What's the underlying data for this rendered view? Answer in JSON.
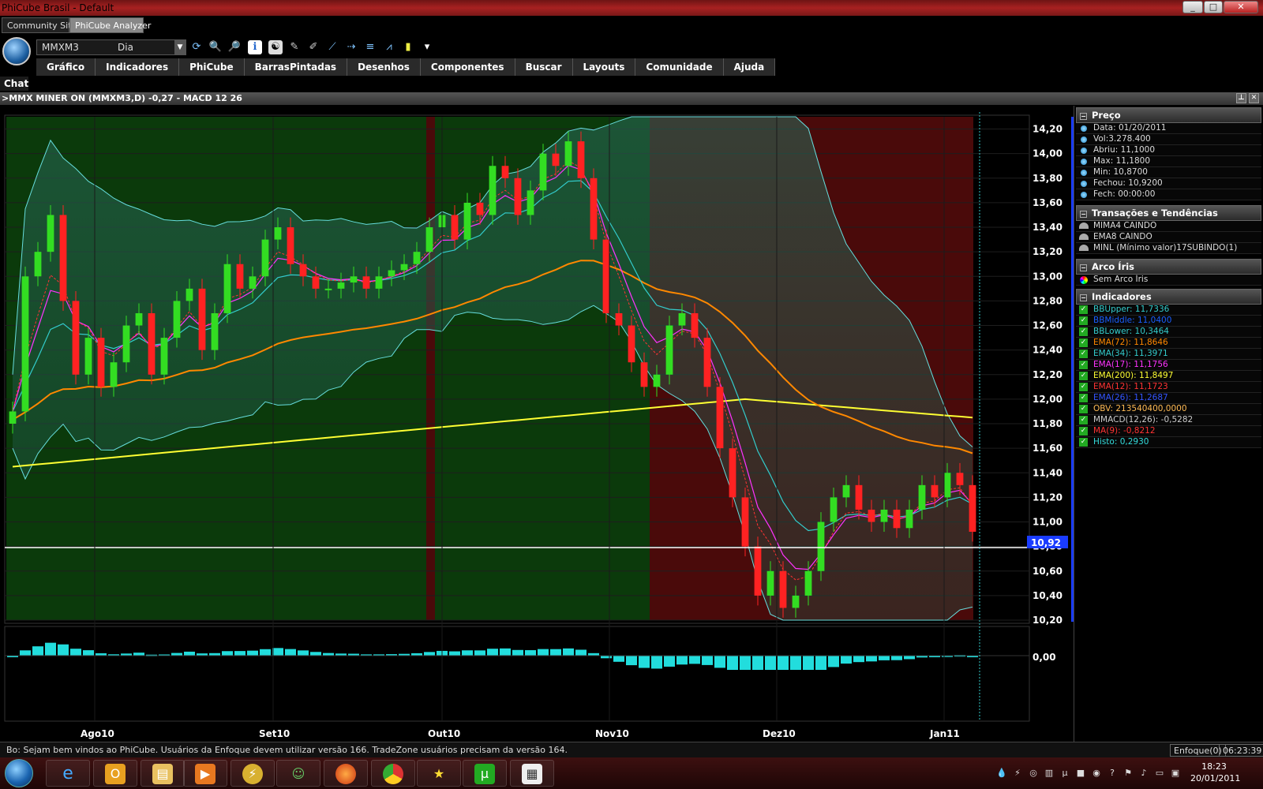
{
  "window": {
    "title": "PhiCube Brasil - Default",
    "buttons": [
      "minimize",
      "maximize",
      "close"
    ]
  },
  "web_tabs": [
    "Community Site",
    "PhiCube Analyzer"
  ],
  "toolbar": {
    "symbol": "MMXM3",
    "period": "Dia",
    "icons": [
      "refresh-icon",
      "zoom-out-icon",
      "zoom-in-icon",
      "info-icon",
      "yin-yang-icon",
      "paint-icon",
      "draw-icon",
      "line-icon",
      "hline-icon",
      "fibonacci-icon",
      "candle-icon",
      "more-icon"
    ]
  },
  "menu": [
    "Gráfico",
    "Indicadores",
    "PhiCube",
    "BarrasPintadas",
    "Desenhos",
    "Componentes",
    "Buscar",
    "Layouts",
    "Comunidade",
    "Ajuda"
  ],
  "chat_label": "Chat",
  "chart_header": ">MMX MINER  ON  (MMXM3,D)  -0,27 - MACD 12 26",
  "chart_data": {
    "type": "candlestick",
    "symbol": "MMXM3",
    "x_labels": [
      "Ago10",
      "Set10",
      "Out10",
      "Nov10",
      "Dez10",
      "Jan11"
    ],
    "y_ticks": [
      "14,20",
      "14,00",
      "13,80",
      "13,60",
      "13,40",
      "13,20",
      "13,00",
      "12,80",
      "12,60",
      "12,40",
      "12,20",
      "12,00",
      "11,80",
      "11,60",
      "11,40",
      "11,20",
      "11,00",
      "10,80",
      "10,60",
      "10,40",
      "10,20"
    ],
    "ylim": [
      10.2,
      14.3
    ],
    "current_price": "10,92",
    "closes": [
      11.9,
      13.0,
      13.2,
      13.5,
      12.8,
      12.2,
      12.5,
      12.1,
      12.3,
      12.6,
      12.7,
      12.2,
      12.5,
      12.8,
      12.9,
      12.4,
      12.7,
      13.1,
      12.9,
      13.0,
      13.3,
      13.4,
      13.1,
      13.0,
      12.9,
      12.9,
      12.95,
      13.0,
      12.9,
      13.0,
      13.05,
      13.1,
      13.2,
      13.4,
      13.5,
      13.3,
      13.6,
      13.5,
      13.9,
      13.8,
      13.5,
      13.7,
      14.0,
      13.9,
      14.1,
      13.8,
      13.3,
      12.7,
      12.6,
      12.3,
      12.1,
      12.2,
      12.6,
      12.7,
      12.5,
      12.1,
      11.6,
      11.2,
      10.8,
      10.4,
      10.6,
      10.3,
      10.4,
      10.6,
      11.0,
      11.2,
      11.3,
      11.1,
      11.0,
      11.1,
      10.95,
      11.1,
      11.3,
      11.2,
      11.4,
      11.3,
      10.92
    ],
    "overlays": [
      {
        "name": "EMA(200)",
        "color": "#ffff33"
      },
      {
        "name": "EMA(72)",
        "color": "#ff8800"
      },
      {
        "name": "EMA(34)",
        "color": "#33cccc"
      },
      {
        "name": "EMA(17)",
        "color": "#ff33ff"
      },
      {
        "name": "EMA(12)",
        "color": "#ff3333"
      },
      {
        "name": "BB",
        "color": "#66dddd"
      }
    ],
    "macd_tick": "0,00"
  },
  "panel": {
    "preco": {
      "title": "Preço",
      "rows": [
        "Data: 01/20/2011",
        "Vol:3.278.400",
        "Abriu: 11,1000",
        "Max: 11,1800",
        "Min: 10,8700",
        "Fechou: 10,9200",
        "Fech: 00:00:00"
      ]
    },
    "transacoes": {
      "title": "Transações e Tendências",
      "rows": [
        "MIMA4 CAINDO",
        "EMA8 CAINDO",
        "MINL (Mínimo valor)17SUBINDO(1)"
      ]
    },
    "arco": {
      "title": "Arco Íris",
      "rows": [
        "Sem Arco Íris"
      ]
    },
    "indicadores": {
      "title": "Indicadores",
      "rows": [
        {
          "text": "BBUpper: 11,7336",
          "color": "#33cccc"
        },
        {
          "text": "BBMiddle: 11,0400",
          "color": "#1a5fff"
        },
        {
          "text": "BBLower: 10,3464",
          "color": "#33cccc"
        },
        {
          "text": "EMA(72): 11,8646",
          "color": "#ff8800"
        },
        {
          "text": "EMA(34): 11,3971",
          "color": "#33cccc"
        },
        {
          "text": "EMA(17): 11,1756",
          "color": "#ff33ff"
        },
        {
          "text": "EMA(200): 11,8497",
          "color": "#ffff33"
        },
        {
          "text": "EMA(12): 11,1723",
          "color": "#ff3333"
        },
        {
          "text": "EMA(26): 11,2687",
          "color": "#3355ff"
        },
        {
          "text": "OBV: 213540400,0000",
          "color": "#ffbb55"
        },
        {
          "text": "MMACD(12,26): -0,5282",
          "color": "#cccccc"
        },
        {
          "text": "MA(9): -0,8212",
          "color": "#ff3333"
        },
        {
          "text": "Histo: 0,2930",
          "color": "#33dddd"
        }
      ]
    }
  },
  "status": {
    "message": "Bo: Sejam bem vindos ao PhiCube.  Usuários da Enfoque devem utilizar versão 166.  TradeZone usuários precisam da versão 164.",
    "enfoque": "Enfoque(0)",
    "time": "06:23:39"
  },
  "taskbar": {
    "apps": [
      "internet-explorer-icon",
      "outlook-icon",
      "explorer-icon",
      "media-player-icon",
      "winamp-icon",
      "messenger-icon",
      "firefox-icon",
      "chrome-icon",
      "favorites-icon",
      "utorrent-icon",
      "phicube-icon"
    ],
    "clock_time": "18:23",
    "clock_date": "20/01/2011"
  }
}
